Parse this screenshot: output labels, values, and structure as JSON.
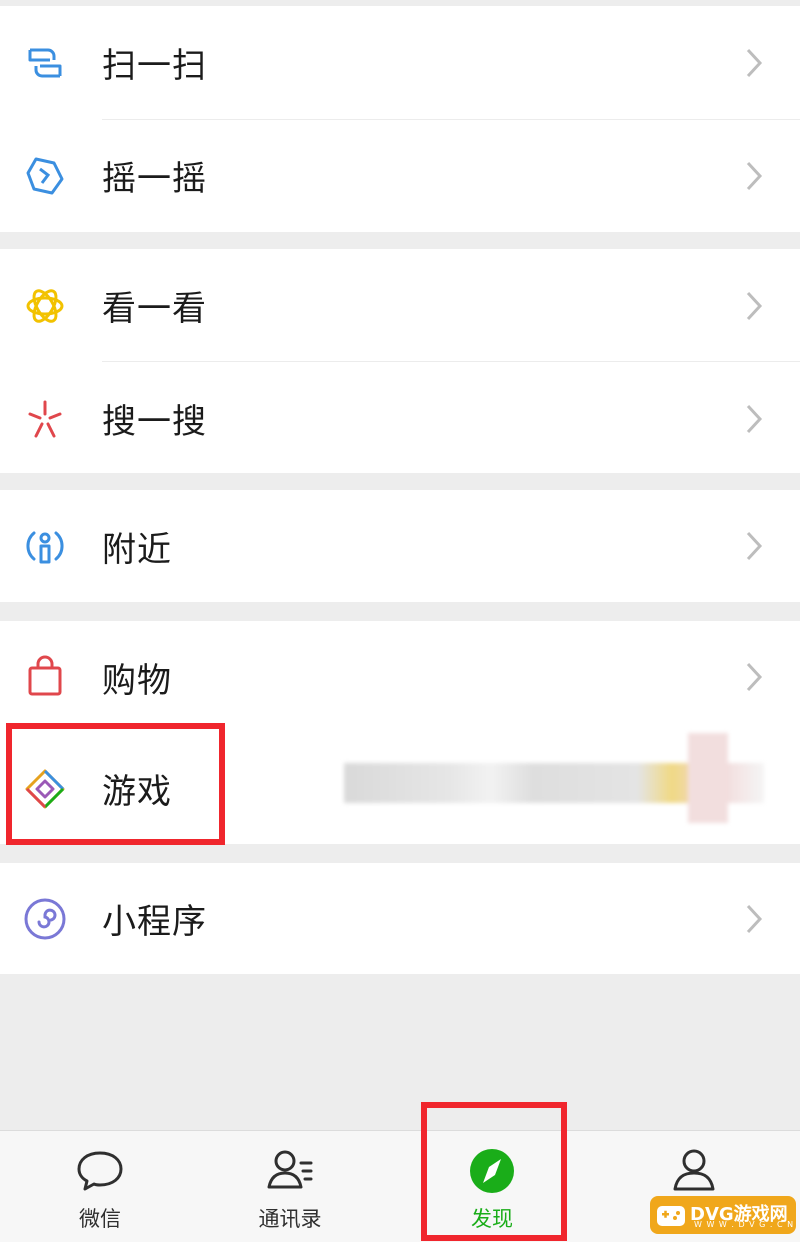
{
  "menu": {
    "scan": "扫一扫",
    "shake": "摇一摇",
    "top_stories": "看一看",
    "search": "搜一搜",
    "nearby": "附近",
    "shopping": "购物",
    "games": "游戏",
    "mini_programs": "小程序"
  },
  "icons": {
    "scan": "scan-icon",
    "shake": "shake-icon",
    "top_stories": "top-stories-icon",
    "search": "search-sparkle-icon",
    "nearby": "nearby-icon",
    "shopping": "shopping-bag-icon",
    "games": "games-icon",
    "mini_programs": "mini-programs-icon"
  },
  "tabbar": {
    "chats": "微信",
    "contacts": "通讯录",
    "discover": "发现",
    "me": "我"
  },
  "watermark": {
    "title": "DVG游戏网",
    "subtitle": "W W W . D V G . C N"
  },
  "colors": {
    "active_tab": "#1aad19",
    "highlight_box": "#f0262d",
    "background": "#ededed"
  }
}
